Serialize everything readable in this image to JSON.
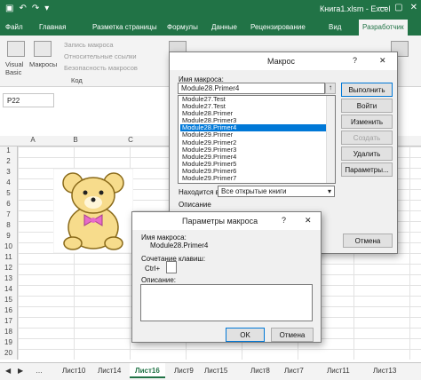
{
  "window": {
    "title": "Книга1.xlsm - Excel",
    "min": "—",
    "max": "▢",
    "close": "✕"
  },
  "qat": {
    "save": "▣",
    "undo": "↶",
    "redo": "↷",
    "more": "▾"
  },
  "tabs": [
    "Файл",
    "Главная",
    "Разметка страницы",
    "Формулы",
    "Данные",
    "Рецензирование",
    "Вид",
    "Разработчик"
  ],
  "ribbon": {
    "visual_basic": "Visual Basic",
    "macros": "Макросы",
    "record": "Запись макроса",
    "relative": "Относительные ссылки",
    "security": "Безопасность макросов",
    "group_code": "Код"
  },
  "namebox": "P22",
  "columns": [
    "A",
    "B",
    "C"
  ],
  "rows": [
    "1",
    "2",
    "3",
    "4",
    "5",
    "6",
    "7",
    "8",
    "9",
    "10",
    "11",
    "12",
    "13",
    "14",
    "15",
    "16",
    "17",
    "18",
    "19",
    "20"
  ],
  "sheets": [
    "Лист10",
    "Лист14",
    "Лист16",
    "Лист9",
    "Лист15",
    "Лист8",
    "Лист7",
    "Лист11",
    "Лист13"
  ],
  "sheet_nav": {
    "prev": "◀",
    "next": "▶",
    "more": "…"
  },
  "macro_dialog": {
    "title": "Макрос",
    "help": "?",
    "close": "✕",
    "name_label": "Имя макроса:",
    "name_value": "Module28.Primer4",
    "list": [
      "Module27.Test",
      "Module27.Test",
      "Module28.Primer",
      "Module28.Primer3",
      "Module28.Primer4",
      "Module29.Primer",
      "Module29.Primer2",
      "Module29.Primer3",
      "Module29.Primer4",
      "Module29.Primer5",
      "Module29.Primer6",
      "Module29.Primer7"
    ],
    "buttons": {
      "run": "Выполнить",
      "step": "Войти",
      "edit": "Изменить",
      "create": "Создать",
      "delete": "Удалить",
      "options": "Параметры..."
    },
    "in_label": "Находится в:",
    "in_value": "Все открытые книги",
    "desc_label": "Описание",
    "cancel": "Отмена"
  },
  "options_dialog": {
    "title": "Параметры макроса",
    "help": "?",
    "close": "✕",
    "name_label": "Имя макроса:",
    "name_value": "Module28.Primer4",
    "shortcut_label": "Сочетание клавиш:",
    "ctrl": "Ctrl+",
    "shortcut_value": "",
    "desc_label": "Описание:",
    "ok": "OK",
    "cancel": "Отмена"
  }
}
